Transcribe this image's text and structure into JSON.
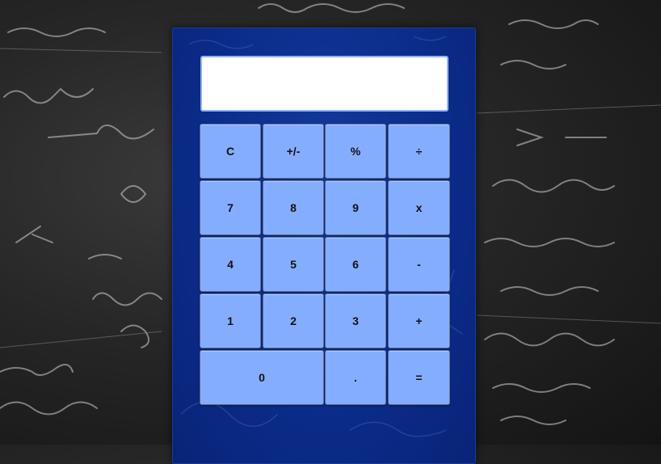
{
  "display": {
    "value": ""
  },
  "keys": {
    "clear": "C",
    "sign": "+/-",
    "percent": "%",
    "divide": "÷",
    "seven": "7",
    "eight": "8",
    "nine": "9",
    "multiply": "x",
    "four": "4",
    "five": "5",
    "six": "6",
    "subtract": "-",
    "one": "1",
    "two": "2",
    "three": "3",
    "add": "+",
    "zero": "0",
    "decimal": ".",
    "equals": "="
  },
  "colors": {
    "background": "#262626",
    "panel": "#0b2c8a",
    "key": "#85adff",
    "display": "#ffffff"
  }
}
